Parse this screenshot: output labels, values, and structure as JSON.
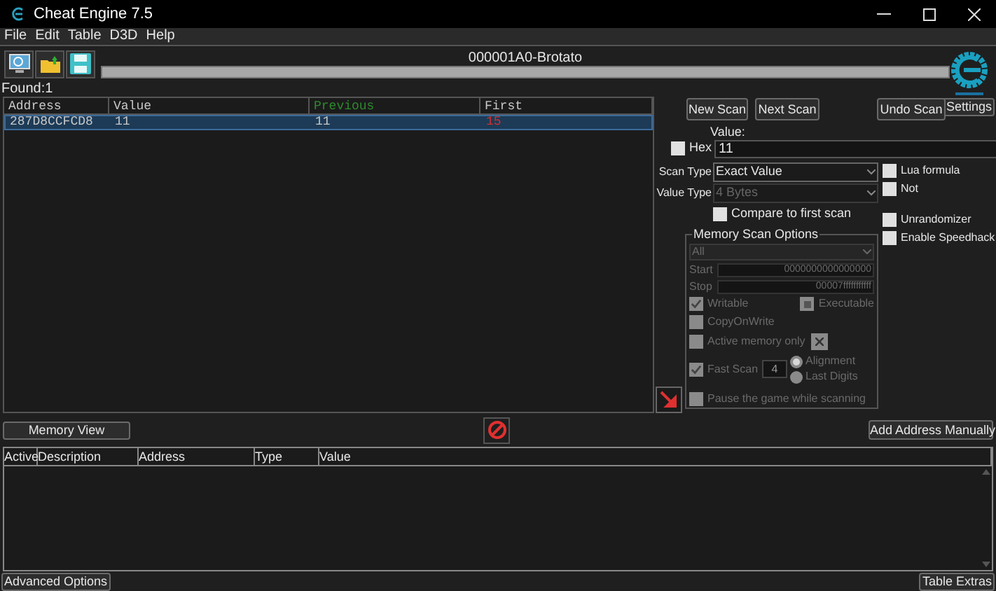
{
  "window": {
    "title": "Cheat Engine 7.5"
  },
  "menu": [
    "File",
    "Edit",
    "Table",
    "D3D",
    "Help"
  ],
  "process": "000001A0-Brotato",
  "progress": {
    "level": 0
  },
  "settings": "Settings",
  "found": "Found:1",
  "results": {
    "columns": [
      "Address",
      "Value",
      "Previous",
      "First"
    ],
    "rows": [
      {
        "selected": true,
        "cells": [
          "287D8CCFCD8",
          "11",
          "11",
          "15"
        ]
      }
    ]
  },
  "scan_buttons": [
    "New Scan",
    "Next Scan",
    "Undo Scan"
  ],
  "value_label": "Value:",
  "hex": {
    "label": "Hex",
    "checked": false
  },
  "value": "11",
  "scan_type": {
    "label": "Scan Type",
    "value": "Exact Value",
    "disabled": false
  },
  "value_type": {
    "label": "Value Type",
    "value": "4 Bytes",
    "disabled": true
  },
  "compare_first": {
    "label": "Compare to first scan",
    "checked": false
  },
  "side_options": [
    {
      "label": "Lua formula",
      "checked": false
    },
    {
      "label": "Not",
      "checked": false
    },
    {
      "label": "Unrandomizer",
      "checked": false
    },
    {
      "label": "Enable Speedhack",
      "checked": false
    }
  ],
  "memory_options": {
    "title": "Memory Scan Options",
    "region": "All",
    "start_label": "Start",
    "start": "0000000000000000",
    "stop_label": "Stop",
    "stop": "00007fffffffffff",
    "writable": {
      "label": "Writable",
      "checked": true
    },
    "executable": {
      "label": "Executable",
      "checked": true,
      "partial": true
    },
    "copy_on_write": {
      "label": "CopyOnWrite",
      "checked": false
    },
    "active_memory": {
      "label": "Active memory only",
      "checked": false
    },
    "fast_scan": {
      "label": "Fast Scan",
      "checked": true,
      "value": "4"
    },
    "alignment": [
      {
        "label": "Alignment",
        "selected": true
      },
      {
        "label": "Last Digits",
        "selected": false
      }
    ],
    "pause": {
      "label": "Pause the game while scanning",
      "checked": false
    }
  },
  "memory_view": "Memory View",
  "add_address": "Add Address Manually",
  "address_table": {
    "columns": [
      "Active",
      "Description",
      "Address",
      "Type",
      "Value"
    ]
  },
  "advanced_options": "Advanced Options",
  "table_extras": "Table Extras"
}
